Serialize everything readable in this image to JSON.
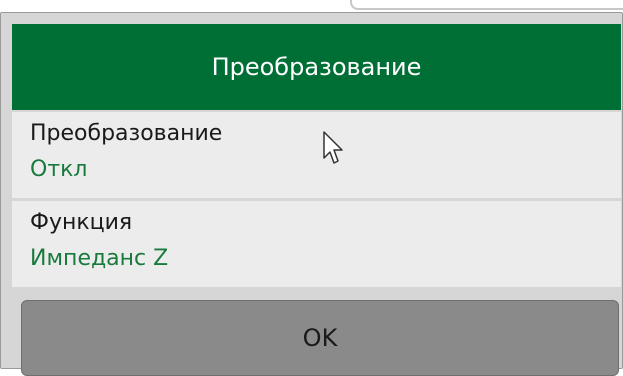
{
  "dialog": {
    "title": "Преобразование"
  },
  "rows": [
    {
      "label": "Преобразование",
      "value": "Откл"
    },
    {
      "label": "Функция",
      "value": "Импеданс Z"
    }
  ],
  "ok_label": "OK",
  "colors": {
    "title_bg": "#006f35",
    "value_text": "#187a3c",
    "button_bg": "#8a8a8a",
    "row_bg": "#ececec",
    "dialog_bg": "#d6d6d6"
  },
  "icons": [
    "mouse-pointer-icon"
  ]
}
